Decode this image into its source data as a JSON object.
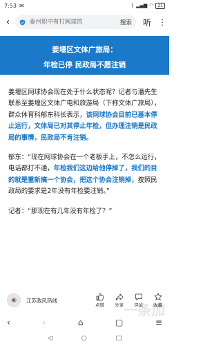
{
  "status": {
    "time": "7:53",
    "battery": "21"
  },
  "search": {
    "placeholder": "泰州职中有打网球的",
    "button": "搜索"
  },
  "header": {
    "listen": "听",
    "more": "⋮"
  },
  "banner": {
    "line1": "姜堰区文体广旅局：",
    "line2": "年检已停 民政局不愿注销"
  },
  "article": {
    "p1_a": "姜堰区网球协会现在处于什么状态呢？记者与潘先生联系至姜堰区文体广电和旅游局（下称文体广旅局），群众体育科郁东科长表示，",
    "p1_hl": "该网球协会目前已基本停止运行，文体局已对其停止年检，但办理注销是民政局的事情，民政局不肯注销。",
    "p2_a": "郁东：“现在网球协会在一个老板手上，不怎么运行，电话都打不通，",
    "p2_hl": "年检我们这边给他停掉了，我们的目的就是重新搞一个协会，把这个协会注销掉，",
    "p2_b": "按照民政局的要求是2年没有年检要注销。”",
    "p3": "记者：“那现在有几年没有年检了？”"
  },
  "footer": {
    "author": "江苏政风热线",
    "like": "点赞",
    "share": "分享",
    "comment": "评论",
    "collect": "收藏"
  },
  "watermark": "一条加"
}
